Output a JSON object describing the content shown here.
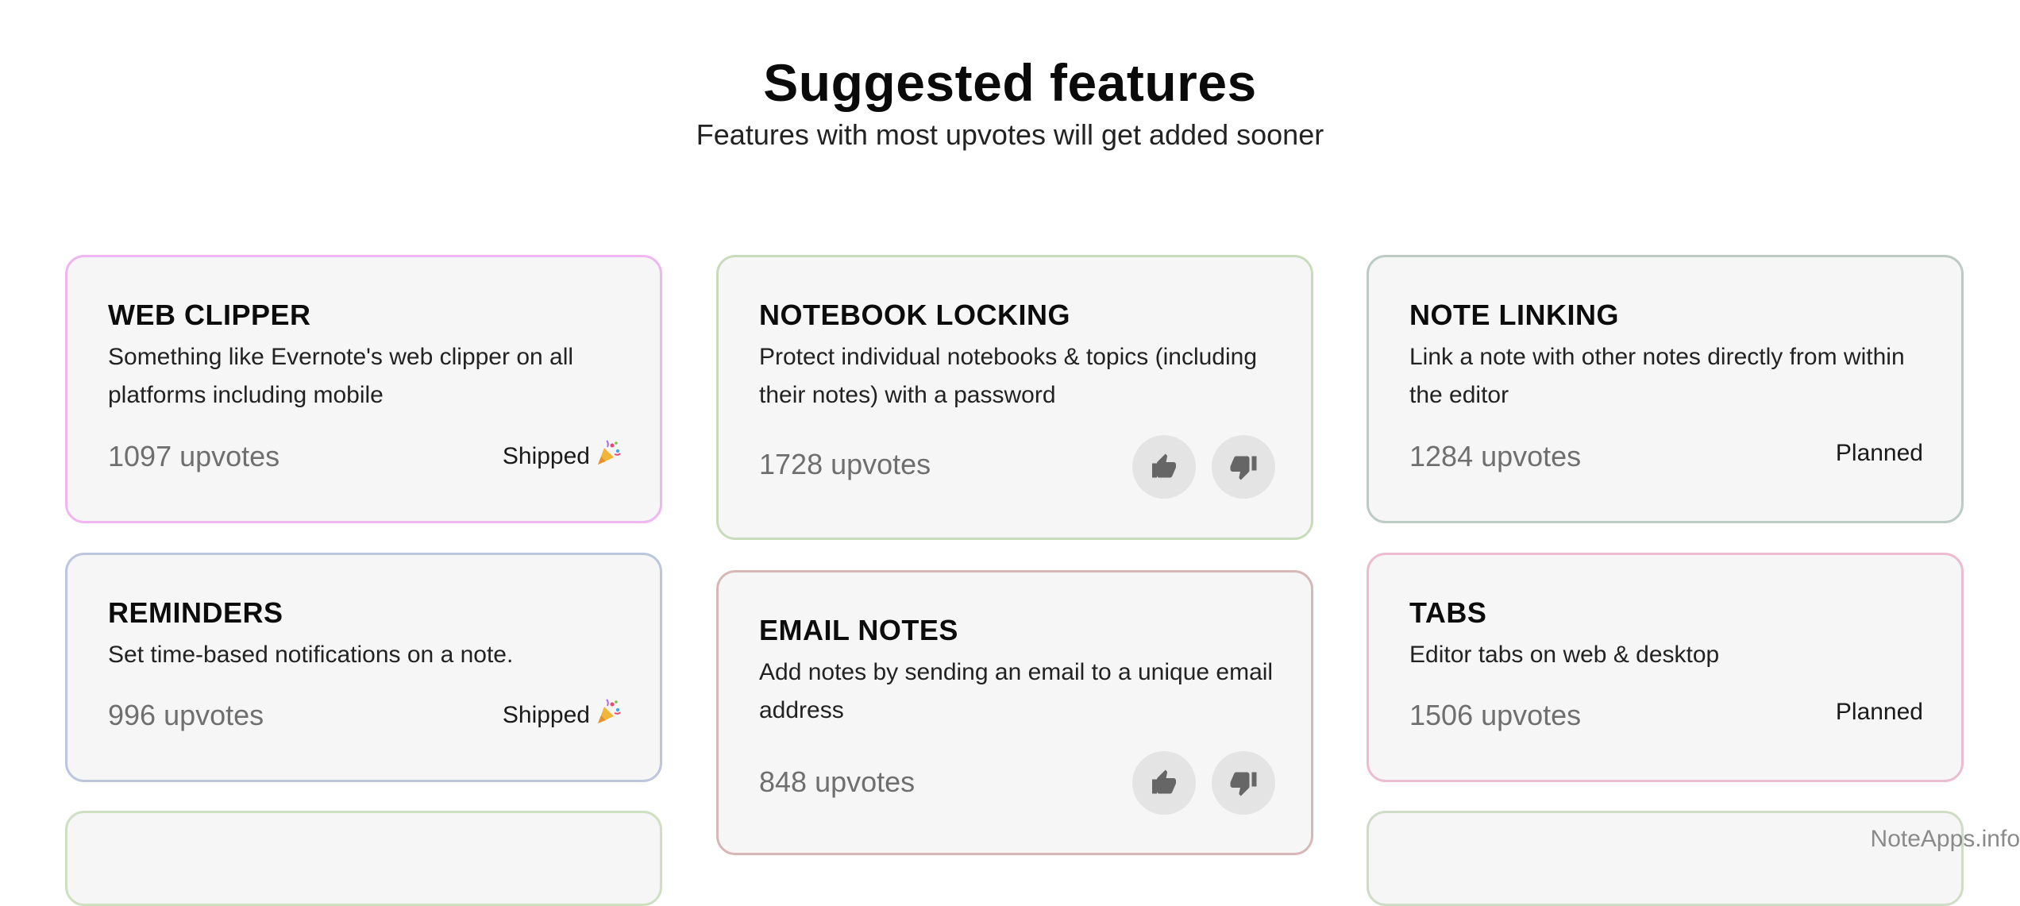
{
  "header": {
    "title": "Suggested features",
    "subtitle": "Features with most upvotes will get added sooner"
  },
  "cards": [
    {
      "title": "WEB CLIPPER",
      "desc": "Something like Evernote's web clipper on all platforms including mobile",
      "upvotes": "1097 upvotes",
      "status": "Shipped",
      "status_icon": "party-popper-icon",
      "border_color": "#efb6ef"
    },
    {
      "title": "NOTEBOOK LOCKING",
      "desc": "Protect individual notebooks & topics (including their notes) with a password",
      "upvotes": "1728 upvotes",
      "status": "",
      "border_color": "#c8dcbc"
    },
    {
      "title": "NOTE LINKING",
      "desc": "Link a note with other notes directly from within the editor",
      "upvotes": "1284 upvotes",
      "status": "Planned",
      "border_color": "#bccbc4"
    },
    {
      "title": "REMINDERS",
      "desc": "Set time-based notifications on a note.",
      "upvotes": "996 upvotes",
      "status": "Shipped",
      "status_icon": "party-popper-icon",
      "border_color": "#bcc6dc"
    },
    {
      "title": "EMAIL NOTES",
      "desc": "Add notes by sending an email to a unique email address",
      "upvotes": "848 upvotes",
      "status": "",
      "border_color": "#d6b8b6"
    },
    {
      "title": "TABS",
      "desc": "Editor tabs on web & desktop",
      "upvotes": "1506 upvotes",
      "status": "Planned",
      "border_color": "#ecbcd0"
    }
  ],
  "partial_card_borders": [
    "#cfe0c2",
    "#cfdcc6"
  ],
  "watermark": "NoteApps.info"
}
